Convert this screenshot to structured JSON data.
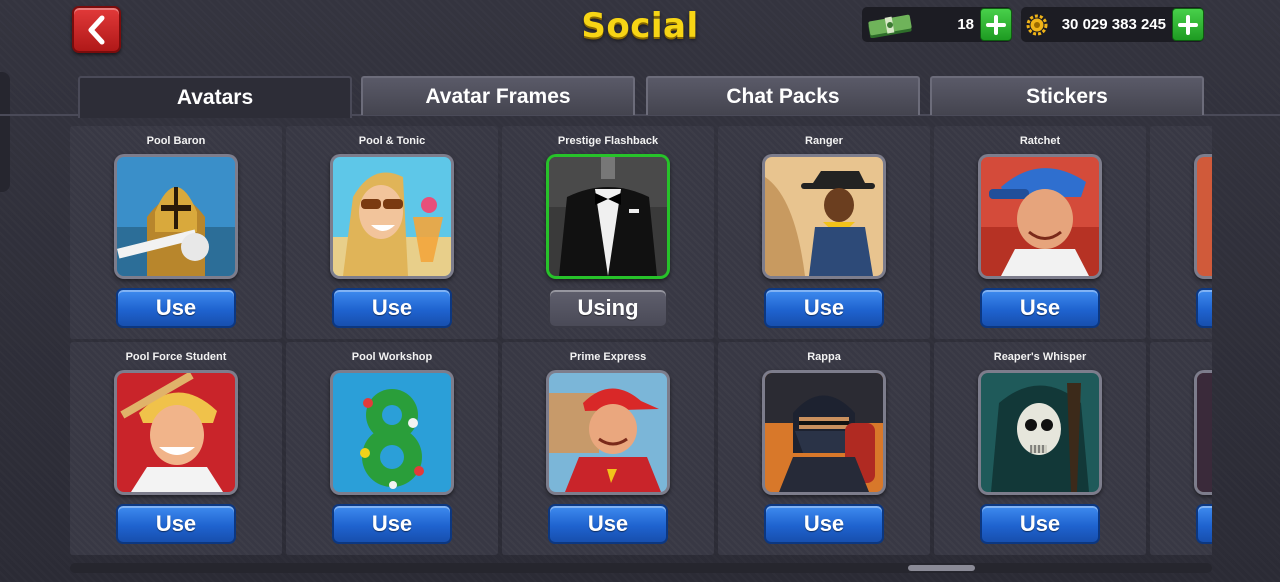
{
  "header": {
    "title": "Social",
    "back_icon": "chevron-left-icon",
    "cash_amount": "18",
    "coins_amount": "30 029 383 245",
    "cash_icon": "cash-stack-icon",
    "coin_icon": "coin-gear-icon",
    "add_icon": "plus-icon"
  },
  "tabs": [
    {
      "label": "Avatars",
      "active": true
    },
    {
      "label": "Avatar Frames",
      "active": false
    },
    {
      "label": "Chat Packs",
      "active": false
    },
    {
      "label": "Stickers",
      "active": false
    }
  ],
  "avatars": [
    {
      "name": "Pool Baron",
      "button": "Use"
    },
    {
      "name": "Pool & Tonic",
      "button": "Use"
    },
    {
      "name": "Prestige Flashback",
      "button": "Using"
    },
    {
      "name": "Ranger",
      "button": "Use"
    },
    {
      "name": "Ratchet",
      "button": "Use"
    },
    {
      "name": "Pool Force Student",
      "button": "Use"
    },
    {
      "name": "Pool Workshop",
      "button": "Use"
    },
    {
      "name": "Prime Express",
      "button": "Use"
    },
    {
      "name": "Rappa",
      "button": "Use"
    },
    {
      "name": "Reaper's Whisper",
      "button": "Use"
    },
    {
      "name": "",
      "button": ""
    },
    {
      "name": "",
      "button": ""
    }
  ],
  "colors": {
    "title": "#f7d515",
    "use_button": "#1f63cf",
    "selected_frame": "#27c22a",
    "back_button": "#c82020",
    "plus_button": "#2fb532"
  }
}
